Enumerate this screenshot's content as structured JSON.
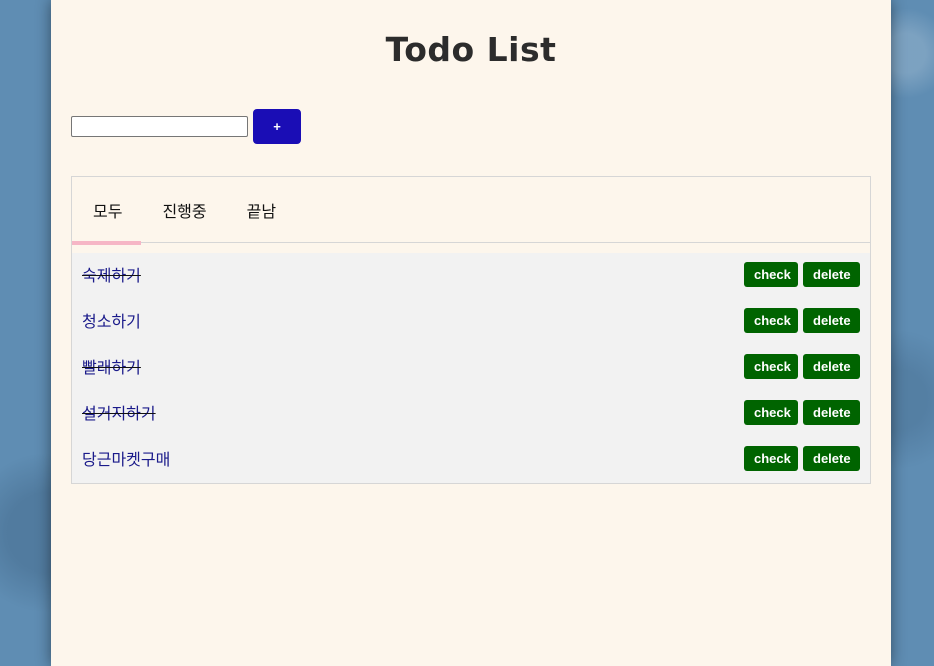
{
  "app": {
    "title": "Todo List"
  },
  "input": {
    "value": "",
    "add_label": "+"
  },
  "tabs": [
    {
      "label": "모두",
      "active": true
    },
    {
      "label": "진행중",
      "active": false
    },
    {
      "label": "끝남",
      "active": false
    }
  ],
  "tasks": [
    {
      "text": "숙제하기",
      "done": true
    },
    {
      "text": "청소하기",
      "done": false
    },
    {
      "text": "빨래하기",
      "done": true
    },
    {
      "text": "설거지하기",
      "done": true
    },
    {
      "text": "당근마켓구매",
      "done": false
    }
  ],
  "buttons": {
    "check_label": "check",
    "delete_label": "delete"
  },
  "colors": {
    "add_button": "#1a0db5",
    "action_button": "#006400",
    "tab_underline": "#f6b6c6",
    "task_text": "#1a1a8a",
    "card_background": "#fdf6ec"
  }
}
